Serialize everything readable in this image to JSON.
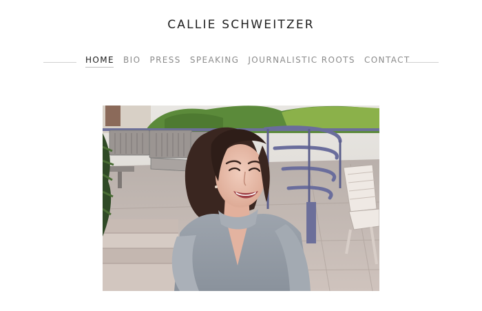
{
  "site": {
    "title": "CALLIE SCHWEITZER"
  },
  "nav": {
    "items": [
      {
        "label": "HOME",
        "active": true
      },
      {
        "label": "BIO",
        "active": false
      },
      {
        "label": "PRESS",
        "active": false
      },
      {
        "label": "SPEAKING",
        "active": false
      },
      {
        "label": "JOURNALISTIC ROOTS",
        "active": false
      },
      {
        "label": "CONTACT",
        "active": false
      }
    ]
  },
  "colors": {
    "title_text": "#1e1e1e",
    "nav_active": "#1a1a1a",
    "nav_inactive": "#8a8a8a",
    "rule": "#cfcfcf"
  }
}
